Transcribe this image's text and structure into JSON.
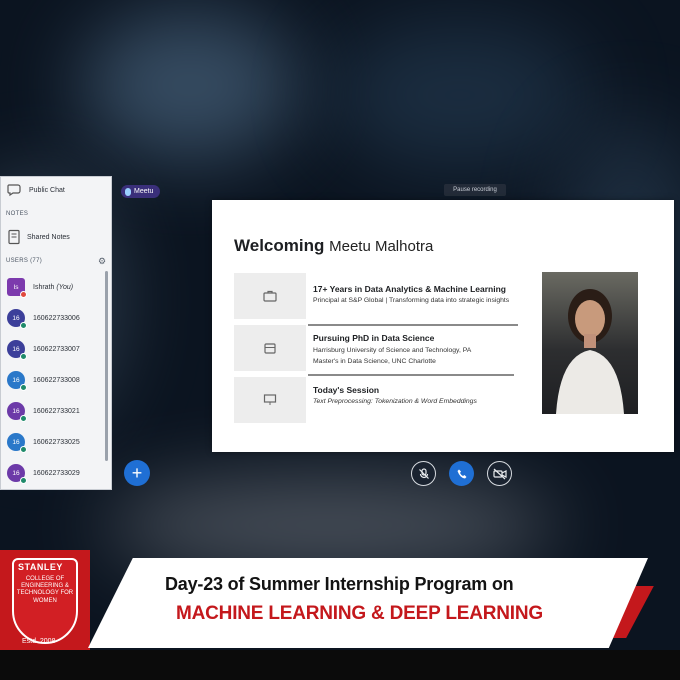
{
  "sidebar": {
    "public_chat": "Public Chat",
    "notes_header": "NOTES",
    "shared_notes": "Shared Notes",
    "users_header": "USERS (77)",
    "users": [
      {
        "initials": "Is",
        "name": "Ishrath",
        "suffix": "(You)",
        "color": "#7c3aad"
      },
      {
        "initials": "16",
        "name": "160622733006",
        "color": "#3c3f9a"
      },
      {
        "initials": "16",
        "name": "160622733007",
        "color": "#3c3f9a"
      },
      {
        "initials": "16",
        "name": "160622733008",
        "color": "#2a78c9"
      },
      {
        "initials": "16",
        "name": "160622733021",
        "color": "#6c3aa8"
      },
      {
        "initials": "16",
        "name": "160622733025",
        "color": "#2a78c9"
      },
      {
        "initials": "16",
        "name": "160622733029",
        "color": "#6c3aa8"
      }
    ]
  },
  "presenter": {
    "name": "Meetu"
  },
  "recording": {
    "label": "Pause recording"
  },
  "slide": {
    "title": "Welcoming",
    "name": "Meetu Malhotra",
    "cards": [
      {
        "title": "17+ Years in Data Analytics & Machine Learning",
        "lines": [
          "Principal at S&P Global | Transforming data into strategic insights"
        ]
      },
      {
        "title": "Pursuing PhD in Data Science",
        "lines": [
          "Harrisburg University of Science and Technology, PA",
          "Master's in Data Science, UNC Charlotte"
        ]
      },
      {
        "title": "Today's Session",
        "lines": [
          "Text Preprocessing: Tokenization & Word Embeddings"
        ]
      }
    ]
  },
  "banner": {
    "college": "STANLEY",
    "college_sub": "COLLEGE OF ENGINEERING & TECHNOLOGY FOR WOMEN",
    "estd": "Estd. 2008",
    "line1": "Day-23 of Summer Internship Program on",
    "line2": "MACHINE LEARNING & DEEP LEARNING"
  },
  "colors": {
    "accent_blue": "#1f6fd4",
    "brand_red": "#c4181c"
  }
}
